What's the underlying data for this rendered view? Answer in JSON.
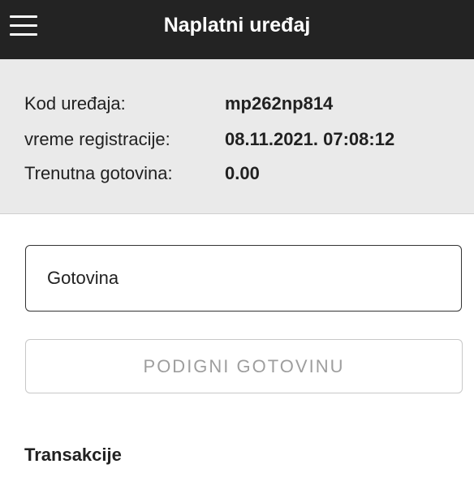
{
  "header": {
    "title": "Naplatni uređaj",
    "menu_icon": "hamburger-menu-icon"
  },
  "device_info": {
    "code_label": "Kod uređaja:",
    "code_value": "mp262np814",
    "registration_label": "vreme registracije:",
    "registration_value": "08.11.2021. 07:08:12",
    "cash_label": "Trenutna gotovina:",
    "cash_value": "0.00"
  },
  "cash_form": {
    "input_placeholder": "Gotovina",
    "input_value": "",
    "withdraw_label": "PODIGNI GOTOVINU"
  },
  "transactions": {
    "heading": "Transakcije"
  },
  "colors": {
    "header_bg": "#232323",
    "panel_bg": "#eaeaea",
    "disabled_text": "#9e9e9e"
  }
}
